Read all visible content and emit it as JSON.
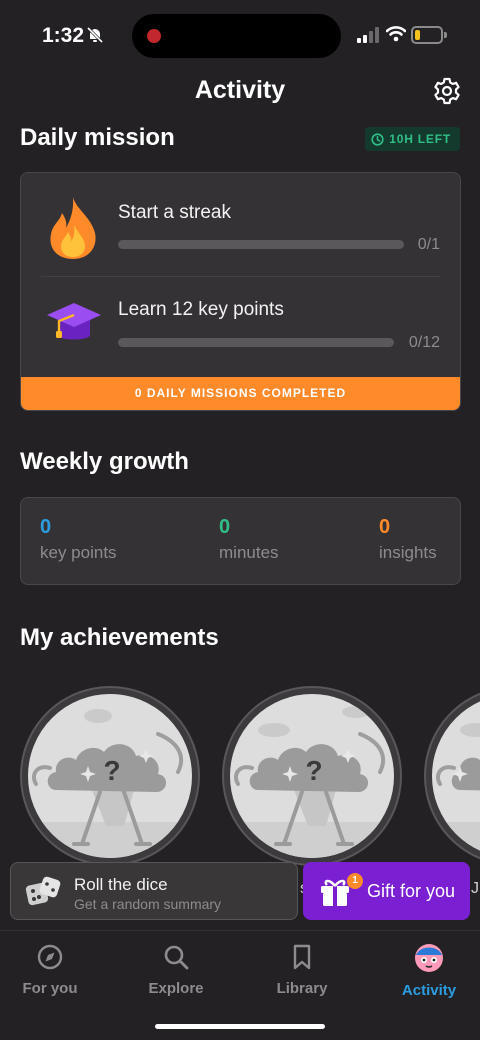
{
  "status_bar": {
    "time": "1:32"
  },
  "header": {
    "title": "Activity"
  },
  "daily_mission": {
    "title": "Daily mission",
    "time_left": "10H LEFT",
    "missions": [
      {
        "label": "Start a streak",
        "count": "0/1",
        "progress": 0,
        "icon": "flame-icon"
      },
      {
        "label": "Learn 12 key points",
        "count": "0/12",
        "progress": 0,
        "icon": "graduation-cap-icon"
      }
    ],
    "footer": "0 DAILY MISSIONS COMPLETED"
  },
  "weekly_growth": {
    "title": "Weekly growth",
    "stats": [
      {
        "value": "0",
        "name": "key points",
        "color": "#2b9ce0"
      },
      {
        "value": "0",
        "name": "minutes",
        "color": "#2fbf86"
      },
      {
        "value": "0",
        "name": "insights",
        "color": "#ff8a2a"
      }
    ]
  },
  "achievements": {
    "title": "My achievements",
    "badge_mark": "?"
  },
  "floating": {
    "dice_title": "Roll the dice",
    "dice_subtitle": "Get a random summary",
    "gift_label": "Gift for you",
    "gift_count": "1",
    "peek_left": "s",
    "peek_right": "J"
  },
  "tabs": [
    {
      "label": "For you",
      "icon": "compass-icon"
    },
    {
      "label": "Explore",
      "icon": "search-icon"
    },
    {
      "label": "Library",
      "icon": "bookmark-icon"
    },
    {
      "label": "Activity",
      "icon": "avatar-icon",
      "active": true
    }
  ],
  "colors": {
    "accent_orange": "#ff8a2a",
    "accent_blue": "#2b9ce0",
    "accent_green": "#2fbf86",
    "gift_purple": "#7b1fd3"
  }
}
